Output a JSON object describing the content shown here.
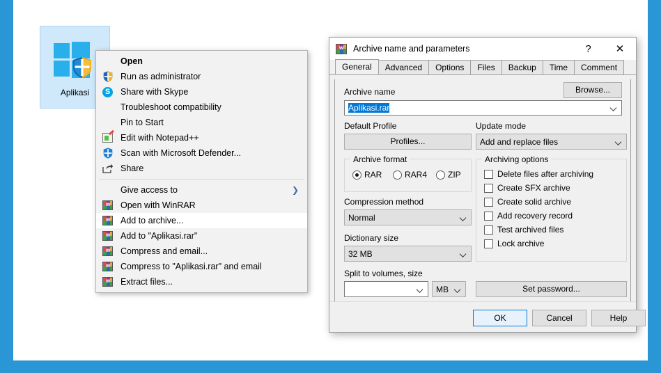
{
  "desktop": {
    "icon": {
      "label": "Aplikasi",
      "glyph": "windows-logo-with-shield",
      "selected": true
    },
    "background_color": "#ffffff",
    "frame_color": "#2b96d6"
  },
  "context_menu": {
    "items": [
      {
        "label": "Open",
        "icon": "",
        "bold": true,
        "highlighted": false,
        "submenu": false
      },
      {
        "label": "Run as administrator",
        "icon": "uac-shield-icon",
        "bold": false,
        "highlighted": false,
        "submenu": false
      },
      {
        "label": "Share with Skype",
        "icon": "skype-icon",
        "bold": false,
        "highlighted": false,
        "submenu": false
      },
      {
        "label": "Troubleshoot compatibility",
        "icon": "",
        "bold": false,
        "highlighted": false,
        "submenu": false
      },
      {
        "label": "Pin to Start",
        "icon": "",
        "bold": false,
        "highlighted": false,
        "submenu": false
      },
      {
        "label": "Edit with Notepad++",
        "icon": "notepadpp-icon",
        "bold": false,
        "highlighted": false,
        "submenu": false
      },
      {
        "label": "Scan with Microsoft Defender...",
        "icon": "defender-shield-icon",
        "bold": false,
        "highlighted": false,
        "submenu": false
      },
      {
        "label": "Share",
        "icon": "share-arrow-icon",
        "bold": false,
        "highlighted": false,
        "submenu": false
      },
      {
        "separator": true
      },
      {
        "label": "Give access to",
        "icon": "",
        "bold": false,
        "highlighted": false,
        "submenu": true
      },
      {
        "label": "Open with WinRAR",
        "icon": "winrar-icon",
        "bold": false,
        "highlighted": false,
        "submenu": false
      },
      {
        "label": "Add to archive...",
        "icon": "winrar-icon",
        "bold": false,
        "highlighted": true,
        "submenu": false
      },
      {
        "label": "Add to \"Aplikasi.rar\"",
        "icon": "winrar-icon",
        "bold": false,
        "highlighted": false,
        "submenu": false
      },
      {
        "label": "Compress and email...",
        "icon": "winrar-icon",
        "bold": false,
        "highlighted": false,
        "submenu": false
      },
      {
        "label": "Compress to \"Aplikasi.rar\" and email",
        "icon": "winrar-icon",
        "bold": false,
        "highlighted": false,
        "submenu": false
      },
      {
        "label": "Extract files...",
        "icon": "winrar-icon",
        "bold": false,
        "highlighted": false,
        "submenu": false
      }
    ]
  },
  "dialog": {
    "title": "Archive name and parameters",
    "title_icon": "winrar-icon",
    "help_button": "?",
    "close_button": "✕",
    "tabs": [
      {
        "label": "General",
        "active": true
      },
      {
        "label": "Advanced",
        "active": false
      },
      {
        "label": "Options",
        "active": false
      },
      {
        "label": "Files",
        "active": false
      },
      {
        "label": "Backup",
        "active": false
      },
      {
        "label": "Time",
        "active": false
      },
      {
        "label": "Comment",
        "active": false
      }
    ],
    "archive_name": {
      "label": "Archive name",
      "value": "Aplikasi.rar",
      "selected": true
    },
    "browse_button": "Browse...",
    "default_profile": {
      "label": "Default Profile",
      "button": "Profiles..."
    },
    "update_mode": {
      "label": "Update mode",
      "value": "Add and replace files"
    },
    "archive_format": {
      "label": "Archive format",
      "options": [
        {
          "label": "RAR",
          "selected": true
        },
        {
          "label": "RAR4",
          "selected": false
        },
        {
          "label": "ZIP",
          "selected": false
        }
      ]
    },
    "compression_method": {
      "label": "Compression method",
      "value": "Normal"
    },
    "dictionary_size": {
      "label": "Dictionary size",
      "value": "32 MB"
    },
    "split_to_volumes": {
      "label": "Split to volumes, size",
      "value": "",
      "unit": "MB"
    },
    "archiving_options": {
      "label": "Archiving options",
      "items": [
        {
          "label": "Delete files after archiving",
          "checked": false
        },
        {
          "label": "Create SFX archive",
          "checked": false
        },
        {
          "label": "Create solid archive",
          "checked": false
        },
        {
          "label": "Add recovery record",
          "checked": false
        },
        {
          "label": "Test archived files",
          "checked": false
        },
        {
          "label": "Lock archive",
          "checked": false
        }
      ]
    },
    "set_password_button": "Set password...",
    "footer": {
      "ok": "OK",
      "cancel": "Cancel",
      "help": "Help"
    },
    "accent_color": "#0078d7"
  }
}
